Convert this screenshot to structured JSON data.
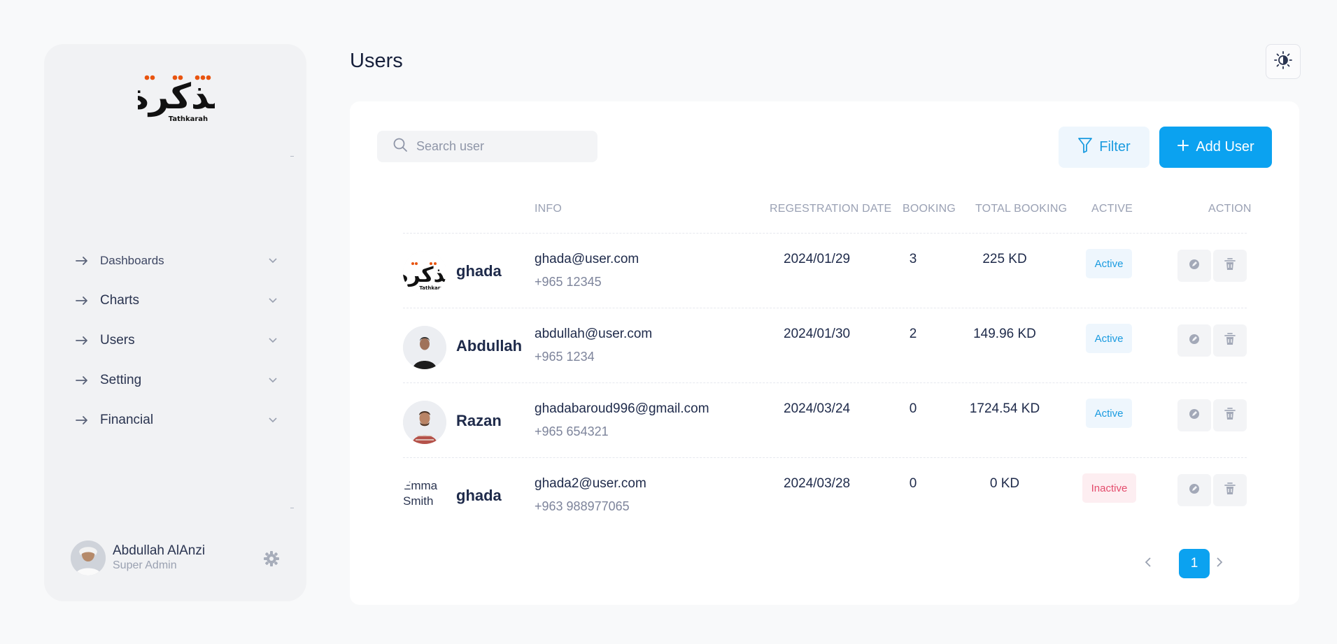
{
  "brand": {
    "logo_text": "تذكرة",
    "logo_subtext": "Tathkarah",
    "accent": "#0ba2f0",
    "logo_dot_color": "#e8540f"
  },
  "page_title": "Users",
  "sidebar": {
    "items": [
      {
        "label": "Dashboards",
        "icon": "arrow-right-icon"
      },
      {
        "label": "Charts",
        "icon": "arrow-right-icon"
      },
      {
        "label": "Users",
        "icon": "arrow-right-icon"
      },
      {
        "label": "Setting",
        "icon": "arrow-right-icon"
      },
      {
        "label": "Financial",
        "icon": "arrow-right-icon"
      }
    ],
    "profile": {
      "name": "Abdullah AlAnzi",
      "role": "Super Admin"
    }
  },
  "toolbar": {
    "search_placeholder": "Search user",
    "filter_label": "Filter",
    "add_label": "Add User"
  },
  "table": {
    "headers": {
      "info": "INFO",
      "reg_date": "REGESTRATION DATE",
      "booking": "BOOKING",
      "total_booking": "TOTAL BOOKING",
      "active": "ACTIVE",
      "action": "ACTION"
    },
    "rows": [
      {
        "name": "ghada",
        "email": "ghada@user.com",
        "phone": "+965 12345",
        "date": "2024/01/29",
        "booking": "3",
        "total": "225 KD",
        "status": "Active",
        "avatar": "logo"
      },
      {
        "name": "Abdullah",
        "email": "abdullah@user.com",
        "phone": "+965 1234",
        "date": "2024/01/30",
        "booking": "2",
        "total": "149.96 KD",
        "status": "Active",
        "avatar": "photo-black-shirt"
      },
      {
        "name": "Razan",
        "email": "ghadabaroud996@gmail.com",
        "phone": "+965 654321",
        "date": "2024/03/24",
        "booking": "0",
        "total": "1724.54 KD",
        "status": "Active",
        "avatar": "photo-plaid-shirt"
      },
      {
        "name": "ghada",
        "email": "ghada2@user.com",
        "phone": "+963 988977065",
        "date": "2024/03/28",
        "booking": "0",
        "total": "0 KD",
        "status": "Inactive",
        "avatar": "broken-image",
        "avatar_alt": "Emma Smith"
      }
    ]
  },
  "pagination": {
    "current": "1"
  }
}
